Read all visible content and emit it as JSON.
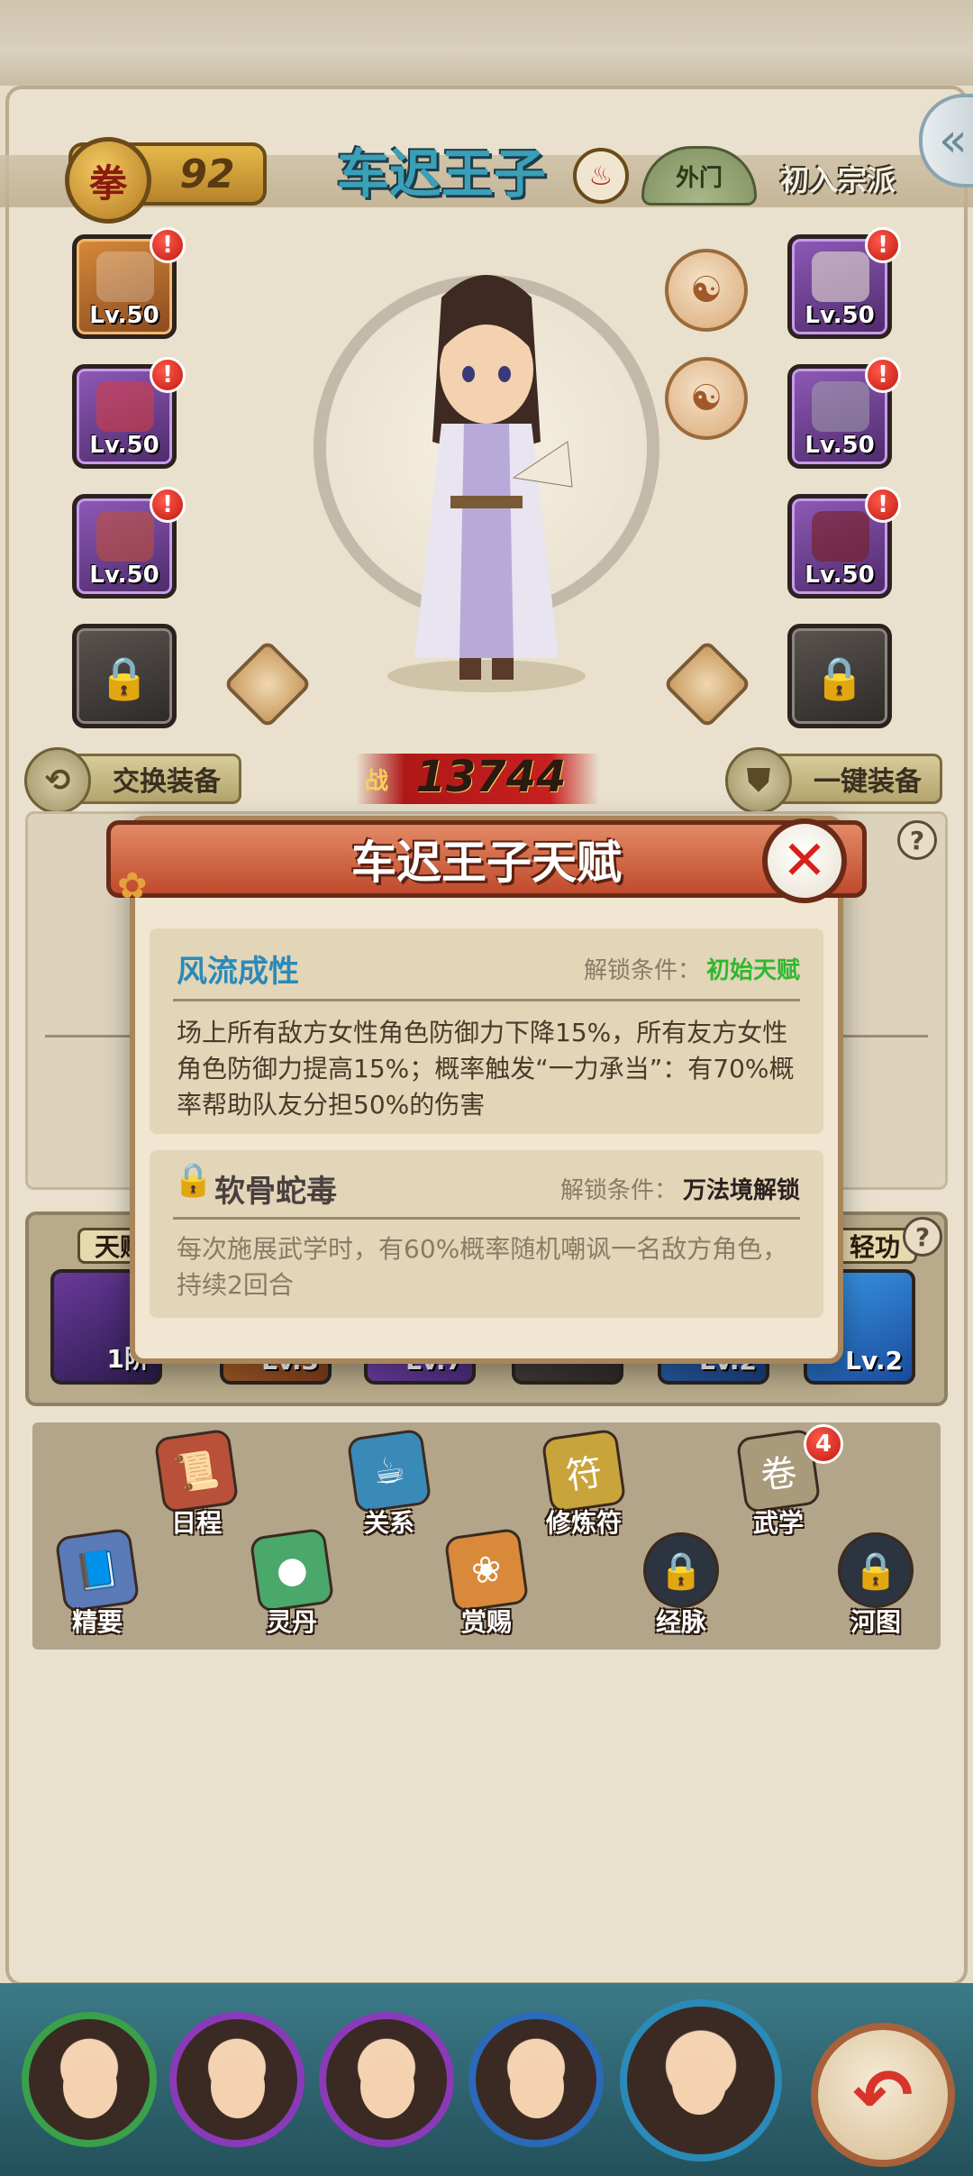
{
  "header": {
    "level": "92",
    "fist_char": "拳",
    "character_name": "车迟王子",
    "rank": "外门",
    "sect_status": "初入宗派"
  },
  "equipment": {
    "left": [
      {
        "level": "Lv.50",
        "rarity": "orange",
        "alert": "!"
      },
      {
        "level": "Lv.50",
        "rarity": "purple",
        "alert": "!"
      },
      {
        "level": "Lv.50",
        "rarity": "purple",
        "alert": "!"
      }
    ],
    "right": [
      {
        "level": "Lv.50",
        "rarity": "purple",
        "alert": "!"
      },
      {
        "level": "Lv.50",
        "rarity": "purple",
        "alert": "!"
      },
      {
        "level": "Lv.50",
        "rarity": "purple",
        "alert": "!"
      }
    ]
  },
  "buttons": {
    "swap_equipment": "交换装备",
    "auto_equip": "一键装备"
  },
  "combat_power": {
    "label": "战",
    "value": "13744"
  },
  "skills": {
    "left_tag": "天赋",
    "right_tag": "轻功",
    "visible_levels": [
      "1阶",
      "Lv.3",
      "Lv.7",
      "Lv.2",
      "Lv.2"
    ]
  },
  "menu": {
    "row1": [
      {
        "label": "日程",
        "icon": "scroll-icon",
        "color": "#b8503a"
      },
      {
        "label": "关系",
        "icon": "teapot-icon",
        "color": "#3a8ab8"
      },
      {
        "label": "修炼符",
        "icon": "talisman-icon",
        "color": "#c8a43a"
      },
      {
        "label": "武学",
        "icon": "scroll-book-icon",
        "color": "#a89a7a",
        "badge": "4"
      }
    ],
    "row2": [
      {
        "label": "精要",
        "icon": "book-icon",
        "color": "#5a7ab8"
      },
      {
        "label": "灵丹",
        "icon": "pills-icon",
        "color": "#4aa86a"
      },
      {
        "label": "赏赐",
        "icon": "fan-icon",
        "color": "#d88a3a"
      },
      {
        "label": "经脉",
        "icon": "lock-icon",
        "locked": true
      },
      {
        "label": "河图",
        "icon": "lock-icon",
        "locked": true
      }
    ]
  },
  "modal": {
    "title": "车迟王子天赋",
    "talents": [
      {
        "name": "风流成性",
        "name_color": "#2a8ab8",
        "condition_label": "解锁条件：",
        "condition_value": "初始天赋",
        "condition_color": "#2fb82f",
        "description": "场上所有敌方女性角色防御力下降15%，所有友方女性角色防御力提高15%；概率触发“一力承当”：有70%概率帮助队友分担50%的伤害",
        "locked": false
      },
      {
        "name": "软骨蛇毒",
        "name_color": "#4a4040",
        "condition_label": "解锁条件：",
        "condition_value": "万法境解锁",
        "condition_color": "#2a2020",
        "description": "每次施展武学时，有60%概率随机嘲讽一名敌方角色，持续2回合",
        "locked": true
      }
    ]
  }
}
